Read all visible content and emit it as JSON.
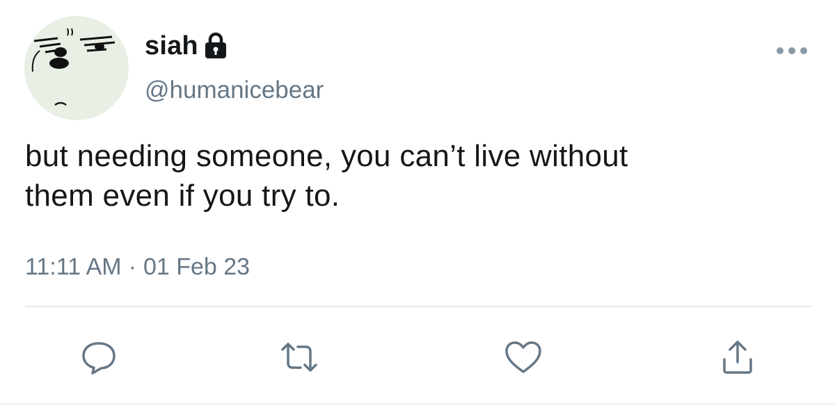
{
  "user": {
    "display_name": "siah",
    "handle": "@humanicebear",
    "protected": true
  },
  "tweet": {
    "text_line1": "but needing someone, you can’t live without",
    "text_line2": "them even if you try to.",
    "time": "11:11 AM",
    "separator": "·",
    "date": "01 Feb 23"
  },
  "icons": {
    "avatar": "avatar-face-icon",
    "lock": "lock-icon",
    "more": "more-dots-icon",
    "reply": "reply-icon",
    "retweet": "retweet-icon",
    "like": "heart-icon",
    "share": "share-icon"
  },
  "colors": {
    "text_primary": "#14171a",
    "text_secondary": "#657786",
    "icon": "#657786",
    "divider": "#e1e8ed",
    "avatar_bg": "#e8efe4"
  }
}
